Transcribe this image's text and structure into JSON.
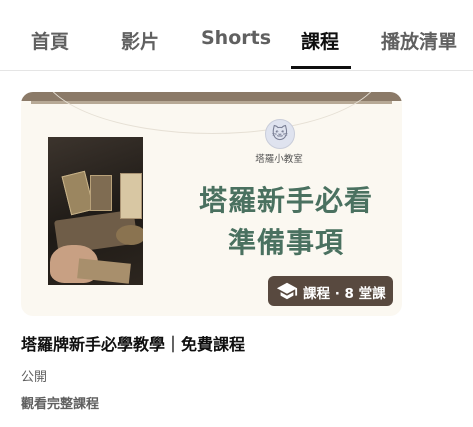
{
  "tabs": [
    {
      "label": "首頁",
      "active": false
    },
    {
      "label": "影片",
      "active": false
    },
    {
      "label": "Shorts",
      "active": false
    },
    {
      "label": "課程",
      "active": true
    },
    {
      "label": "播放清單",
      "active": false
    }
  ],
  "course": {
    "thumbnail": {
      "studio_name": "塔羅小教室",
      "headline_line1": "塔羅新手必看",
      "headline_line2": "準備事項",
      "avatar_icon": "cat-avatar-icon"
    },
    "badge": {
      "text": "課程 · 8 堂課",
      "icon": "graduation-cap-icon"
    },
    "title": "塔羅牌新手必學教學｜免費課程",
    "visibility": "公開",
    "view_full_course": "觀看完整課程"
  },
  "colors": {
    "active_tab": "#0f0f0f",
    "inactive_tab": "#606060",
    "thumbnail_title": "#4a7160",
    "badge_bg": "#3c2c22"
  }
}
